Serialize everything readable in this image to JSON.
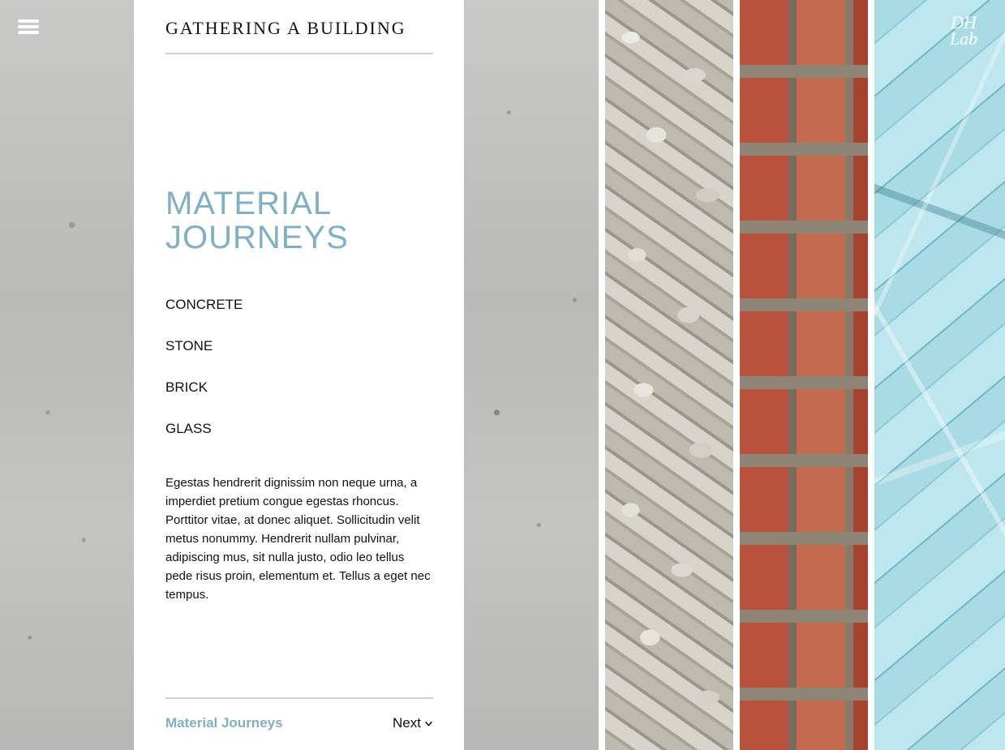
{
  "header": {
    "site_title": "GATHERING A BUILDING",
    "menu_icon": "hamburger-menu-icon",
    "logo_text": "DH Lab"
  },
  "section": {
    "title": "MATERIAL JOURNEYS"
  },
  "nav": {
    "items": [
      {
        "label": "CONCRETE"
      },
      {
        "label": "STONE"
      },
      {
        "label": "BRICK"
      },
      {
        "label": "GLASS"
      }
    ]
  },
  "body": {
    "paragraph": "Egestas hendrerit dignissim non neque urna, a imperdiet pretium congue egestas rhoncus. Porttitor vitae, at donec aliquet. Sollicitudin velit metus nonummy. Hendrerit nullam pulvinar, adipiscing mus, sit nulla justo, odio leo tellus pede risus proin, elementum et. Tellus a eget nec tempus."
  },
  "footer": {
    "current": "Material Journeys",
    "next_label": "Next",
    "next_icon": "chevron-down-icon"
  },
  "colors": {
    "accent": "#7fb0c8",
    "text": "#111111",
    "panel": "#ffffff"
  }
}
